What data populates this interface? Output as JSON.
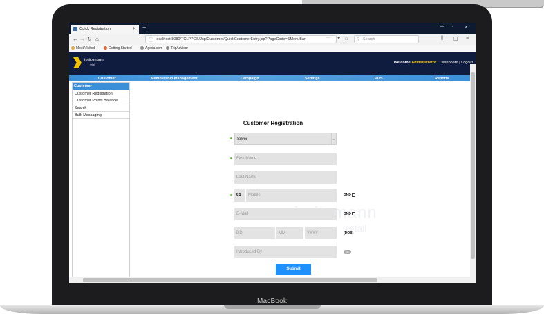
{
  "device": {
    "label": "MacBook"
  },
  "browser": {
    "tab_title": "Quick Registration",
    "new_tab": "+",
    "url": "localhost:8080/TCLPPOS/Jsp/Customer/QuickCustomerEntry.jsp?PageCode=&MenuBar",
    "url_more": "···",
    "search_placeholder": "Search",
    "bookmarks": [
      "Most Visited",
      "Getting Started",
      "Agoda.com",
      "TripAdvisor"
    ]
  },
  "app": {
    "logo_text": "boltzmann",
    "logo_sub": "retail",
    "welcome_prefix": "Welcome",
    "user": "Administrator",
    "links_sep": "|",
    "dashboard": "Dashboard",
    "logout": "Logout"
  },
  "menu": [
    "Customer",
    "Membership Management",
    "Campaign",
    "Settings",
    "POS",
    "Reports"
  ],
  "sidebar": {
    "title": "Customer",
    "items": [
      "Customer Registration",
      "Customer Points Balance",
      "Search",
      "Bulk Messaging"
    ]
  },
  "form": {
    "title": "Customer Registration",
    "tier_value": "Silver",
    "first_name_ph": "First Name",
    "last_name_ph": "Last Name",
    "country_code": "91",
    "mobile_ph": "Mobile",
    "dnd_label": "DND",
    "email_ph": "E-Mail",
    "dd_ph": "DD",
    "mm_ph": "MM",
    "yyyy_ph": "YYYY",
    "dob_label": "(DOB)",
    "introduced_ph": "Introduced By",
    "toggle_text": "NO",
    "submit_label": "Submit"
  },
  "watermark": {
    "line1": "boltzmann",
    "line2": "retail"
  },
  "colors": {
    "header": "#0f1c3f",
    "menu": "#3a8fd8",
    "accent": "#f2c200",
    "submit": "#1e90ff",
    "required_dot": "#6cbe3a"
  }
}
